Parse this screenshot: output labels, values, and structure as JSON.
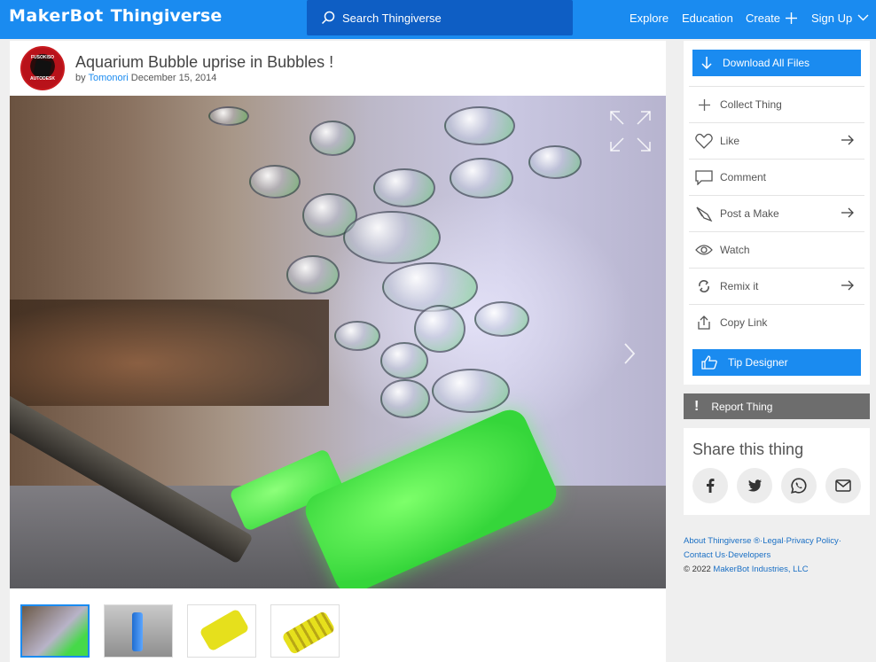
{
  "header": {
    "logo_part1": "MakerBot",
    "logo_part2": "Thingiverse",
    "search_placeholder": "Search Thingiverse",
    "nav": {
      "explore": "Explore",
      "education": "Education",
      "create": "Create",
      "signup": "Sign Up"
    },
    "bg_color": "#1a8bf0"
  },
  "thing": {
    "title": "Aquarium Bubble uprise in Bubbles !",
    "by_prefix": "by",
    "author": "Tomonori",
    "date": "December 15, 2014",
    "avatar_text_top": "FUSOKISO",
    "avatar_text_bottom": "AUTODESK"
  },
  "actions": {
    "download": "Download All Files",
    "collect": "Collect Thing",
    "like": "Like",
    "comment": "Comment",
    "post_make": "Post a Make",
    "watch": "Watch",
    "remix": "Remix it",
    "copy_link": "Copy Link",
    "tip": "Tip Designer",
    "report": "Report Thing"
  },
  "share": {
    "heading": "Share this thing"
  },
  "footer": {
    "about": "About Thingiverse",
    "reg": "®·",
    "legal": "Legal",
    "sep1": "·",
    "privacy": "Privacy Policy",
    "sep2": "·",
    "contact": "Contact Us",
    "sep3": "·",
    "developers": "Developers",
    "copyright": "©  2022 ",
    "company": "MakerBot Industries, LLC"
  }
}
